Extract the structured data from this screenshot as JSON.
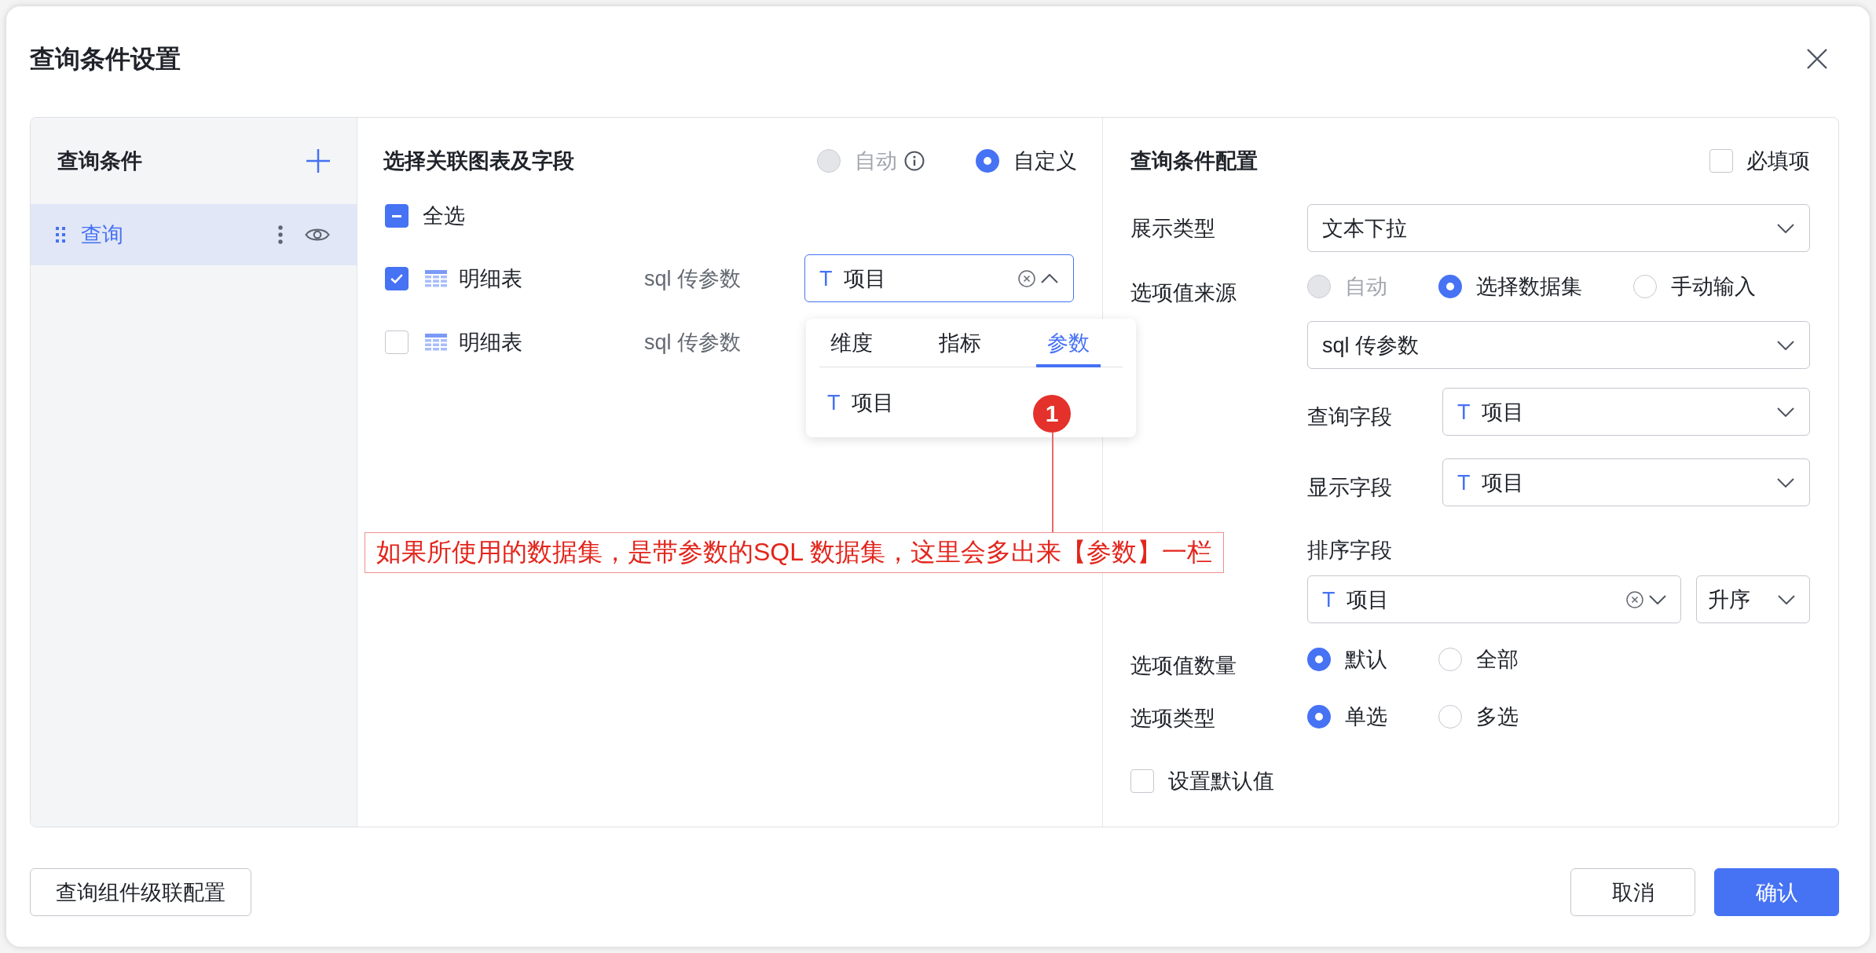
{
  "dialog": {
    "title": "查询条件设置"
  },
  "conditions": {
    "title": "查询条件",
    "items": [
      {
        "label": "查询",
        "selected": true
      }
    ]
  },
  "link": {
    "title": "选择关联图表及字段",
    "modes": [
      {
        "label": "自动",
        "selected": false,
        "disabled": true,
        "info": true
      },
      {
        "label": "自定义",
        "selected": true,
        "disabled": false,
        "info": false
      }
    ],
    "select_all": {
      "label": "全选",
      "indeterminate": true
    },
    "rows": [
      {
        "checked": true,
        "table": "明细表",
        "dataset": "sql 传参数",
        "field": {
          "type": "T",
          "value": "项目",
          "open": true,
          "clearable": true
        }
      },
      {
        "checked": false,
        "table": "明细表",
        "dataset": "sql 传参数"
      }
    ],
    "dropdown": {
      "tabs": [
        {
          "label": "维度",
          "selected": false
        },
        {
          "label": "指标",
          "selected": false
        },
        {
          "label": "参数",
          "selected": true
        }
      ],
      "items": [
        {
          "type": "T",
          "label": "项目"
        }
      ]
    }
  },
  "callout": {
    "number": "1",
    "text": "如果所使用的数据集，是带参数的SQL 数据集，这里会多出来【参数】一栏"
  },
  "config": {
    "title": "查询条件配置",
    "required": {
      "label": "必填项",
      "checked": false
    },
    "display_type": {
      "label": "展示类型",
      "field": {
        "value": "文本下拉"
      }
    },
    "option_source": {
      "label": "选项值来源",
      "options": [
        {
          "label": "自动",
          "selected": false,
          "disabled": true
        },
        {
          "label": "选择数据集",
          "selected": true,
          "disabled": false
        },
        {
          "label": "手动输入",
          "selected": false,
          "disabled": false
        }
      ],
      "dataset": {
        "value": "sql 传参数"
      }
    },
    "query_field": {
      "label": "查询字段",
      "field": {
        "type": "T",
        "value": "项目"
      }
    },
    "display_field": {
      "label": "显示字段",
      "field": {
        "type": "T",
        "value": "项目"
      }
    },
    "sort_field": {
      "label": "排序字段",
      "field": {
        "type": "T",
        "value": "项目",
        "clearable": true
      },
      "order": {
        "value": "升序"
      }
    },
    "option_count": {
      "label": "选项值数量",
      "options": [
        {
          "label": "默认",
          "selected": true,
          "disabled": false
        },
        {
          "label": "全部",
          "selected": false,
          "disabled": false
        }
      ]
    },
    "option_type": {
      "label": "选项类型",
      "options": [
        {
          "label": "单选",
          "selected": true,
          "disabled": false
        },
        {
          "label": "多选",
          "selected": false,
          "disabled": false
        }
      ]
    },
    "default_value": {
      "label": "设置默认值",
      "checked": false
    }
  },
  "footer": {
    "left": [
      {
        "label": "查询组件级联配置",
        "primary": false
      }
    ],
    "right": [
      {
        "label": "取消",
        "primary": false
      },
      {
        "label": "确认",
        "primary": true
      }
    ]
  }
}
